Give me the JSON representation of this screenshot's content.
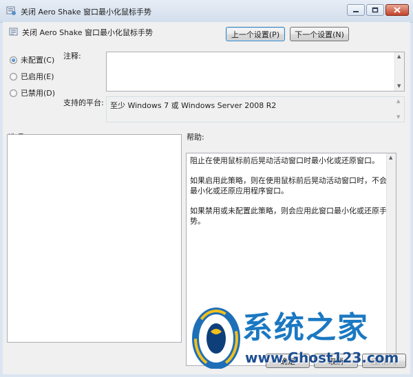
{
  "window": {
    "title": "关闭 Aero Shake 窗口最小化鼠标手势",
    "controls": {
      "minimize_icon": "minimize-icon",
      "maximize_icon": "maximize-icon",
      "close_icon": "close-icon"
    }
  },
  "header": {
    "policy_name": "关闭 Aero Shake 窗口最小化鼠标手势",
    "prev_button": "上一个设置(P)",
    "next_button": "下一个设置(N)"
  },
  "state_options": [
    {
      "label": "未配置(C)",
      "selected": true
    },
    {
      "label": "已启用(E)",
      "selected": false
    },
    {
      "label": "已禁用(D)",
      "selected": false
    }
  ],
  "comment": {
    "label": "注释:",
    "value": ""
  },
  "platform": {
    "label": "支持的平台:",
    "value": "至少 Windows 7 或 Windows Server 2008 R2"
  },
  "options_label": "选项:",
  "help": {
    "label": "帮助:",
    "paragraphs": [
      "阻止在使用鼠标前后晃动活动窗口时最小化或还原窗口。",
      "如果启用此策略，则在使用鼠标前后晃动活动窗口时，不会最小化或还原应用程序窗口。",
      "如果禁用或未配置此策略，则会应用此窗口最小化或还原手势。"
    ]
  },
  "footer": {
    "ok": "确定",
    "cancel": "取消",
    "apply": "应用(A)"
  },
  "watermark": {
    "chinese": "系统之家",
    "url": "www.Ghost123.com"
  }
}
